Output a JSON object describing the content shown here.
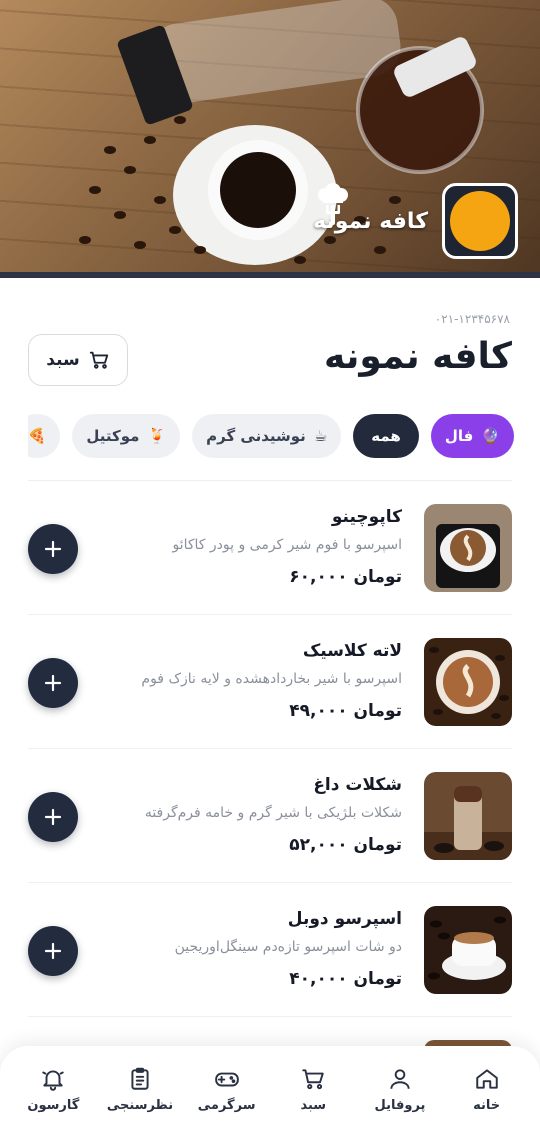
{
  "header": {
    "brand_name": "کافه نمونه",
    "phone": "۰۲۱-۱۲۳۴۵۶۷۸",
    "title": "کافه نمونه",
    "cart_label": "سبد"
  },
  "categories": [
    {
      "label": "فال",
      "icon": "crystal-ball-icon",
      "emoji": "🔮",
      "active": false,
      "style": "purple"
    },
    {
      "label": "همه",
      "icon": "",
      "emoji": "",
      "active": true,
      "style": "dark"
    },
    {
      "label": "نوشیدنی گرم",
      "icon": "hot-drink-icon",
      "emoji": "☕",
      "active": false,
      "style": "light"
    },
    {
      "label": "موکتیل",
      "icon": "cocktail-icon",
      "emoji": "🍹",
      "active": false,
      "style": "light"
    },
    {
      "label": "",
      "icon": "pizza-icon",
      "emoji": "🍕",
      "active": false,
      "style": "light"
    }
  ],
  "products": [
    {
      "name": "کاپوچینو",
      "description": "اسپرسو با فوم شیر کرمی و پودر کاکائو",
      "price": "۶۰,۰۰۰ تومان",
      "thumb": "cappuccino-image"
    },
    {
      "name": "لاته کلاسیک",
      "description": "اسپرسو با شیر بخاردادهشده و لایه نازک فوم",
      "price": "۴۹,۰۰۰ تومان",
      "thumb": "latte-image"
    },
    {
      "name": "شکلات داغ",
      "description": "شکلات بلژیکی با شیر گرم و خامه فرم‌گرفته",
      "price": "۵۲,۰۰۰ تومان",
      "thumb": "hot-chocolate-image"
    },
    {
      "name": "اسپرسو دوبل",
      "description": "دو شات اسپرسو تازه‌دم سینگل‌اوریجین",
      "price": "۴۰,۰۰۰ تومان",
      "thumb": "espresso-image"
    }
  ],
  "nav": [
    {
      "label": "خانه",
      "icon": "home-icon"
    },
    {
      "label": "پروفایل",
      "icon": "user-icon"
    },
    {
      "label": "سبد",
      "icon": "cart-icon"
    },
    {
      "label": "سرگرمی",
      "icon": "gamepad-icon"
    },
    {
      "label": "نظرسنجی",
      "icon": "clipboard-icon"
    },
    {
      "label": "گارسون",
      "icon": "bell-icon"
    }
  ],
  "colors": {
    "accent_dark": "#232b3e",
    "fal_purple": "#8b3fe8",
    "logo_orange": "#f5a511"
  }
}
